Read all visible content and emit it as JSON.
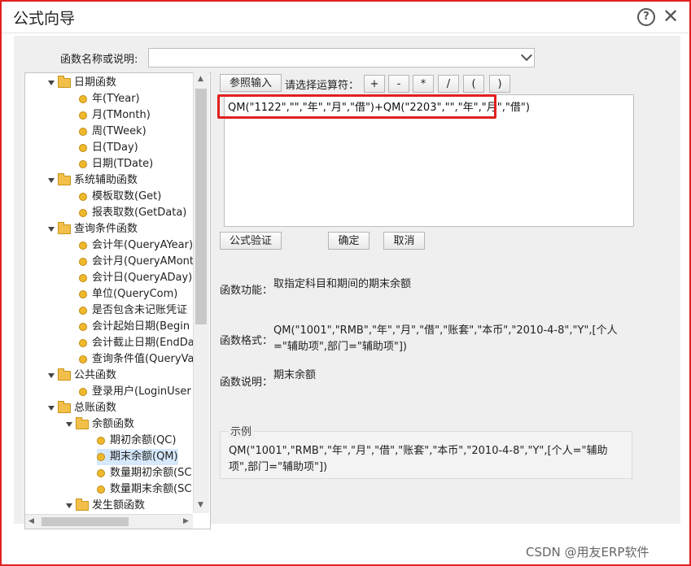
{
  "window": {
    "title": "公式向导"
  },
  "search": {
    "label": "函数名称或说明:",
    "value": ""
  },
  "tree": {
    "items": [
      {
        "label": "日期函数",
        "type": "folder"
      },
      {
        "label": "年(TYear)",
        "type": "leaf"
      },
      {
        "label": "月(TMonth)",
        "type": "leaf"
      },
      {
        "label": "周(TWeek)",
        "type": "leaf"
      },
      {
        "label": "日(TDay)",
        "type": "leaf"
      },
      {
        "label": "日期(TDate)",
        "type": "leaf"
      },
      {
        "label": "系统辅助函数",
        "type": "folder"
      },
      {
        "label": "模板取数(Get)",
        "type": "leaf"
      },
      {
        "label": "报表取数(GetData)",
        "type": "leaf"
      },
      {
        "label": "查询条件函数",
        "type": "folder"
      },
      {
        "label": "会计年(QueryAYear)",
        "type": "leaf"
      },
      {
        "label": "会计月(QueryAMont",
        "type": "leaf"
      },
      {
        "label": "会计日(QueryADay)",
        "type": "leaf"
      },
      {
        "label": "单位(QueryCom)",
        "type": "leaf"
      },
      {
        "label": "是否包含未记账凭证",
        "type": "leaf"
      },
      {
        "label": "会计起始日期(Begin",
        "type": "leaf"
      },
      {
        "label": "会计截止日期(EndDa",
        "type": "leaf"
      },
      {
        "label": "查询条件值(QueryVa",
        "type": "leaf"
      },
      {
        "label": "公共函数",
        "type": "folder"
      },
      {
        "label": "登录用户(LoginUser",
        "type": "leaf"
      },
      {
        "label": "总账函数",
        "type": "folder"
      },
      {
        "label": "余额函数",
        "type": "folder"
      },
      {
        "label": "期初余额(QC)",
        "type": "leaf"
      },
      {
        "label": "期末余额(QM)",
        "type": "leaf"
      },
      {
        "label": "数量期初余额(SC",
        "type": "leaf"
      },
      {
        "label": "数量期末余额(SC",
        "type": "leaf"
      },
      {
        "label": "发生额函数",
        "type": "folder"
      }
    ]
  },
  "toolbar": {
    "ref_input_label": "参照输入",
    "operator_label": "请选择运算符：",
    "operators": [
      "+",
      "-",
      "*",
      "/",
      "(",
      ")"
    ]
  },
  "editor": {
    "formula": "QM(\"1122\",\"\",\"年\",\"月\",\"借\")+QM(\"2203\",\"\",\"年\",\"月\",\"借\")"
  },
  "actions": {
    "validate_label": "公式验证",
    "ok_label": "确定",
    "cancel_label": "取消"
  },
  "description": {
    "function_label": "函数功能：",
    "function_value": "取指定科目和期间的期末余额",
    "format_label": "函数格式：",
    "format_value": "QM(\"1001\",\"RMB\",\"年\",\"月\",\"借\",\"账套\",\"本币\",\"2010-4-8\",\"Y\",[个人=\"辅助项\",部门=\"辅助项\"])",
    "note_label": "函数说明：",
    "note_value": "期末余额"
  },
  "example": {
    "title": "示例",
    "value": "QM(\"1001\",\"RMB\",\"年\",\"月\",\"借\",\"账套\",\"本币\",\"2010-4-8\",\"Y\",[个人=\"辅助项\",部门=\"辅助项\"])"
  },
  "watermark": {
    "text": "CSDN @用友ERP软件"
  },
  "colors": {
    "highlight": "#e0211f",
    "folder": "#f2c04a",
    "leaf_dot": "#f0b92d"
  }
}
